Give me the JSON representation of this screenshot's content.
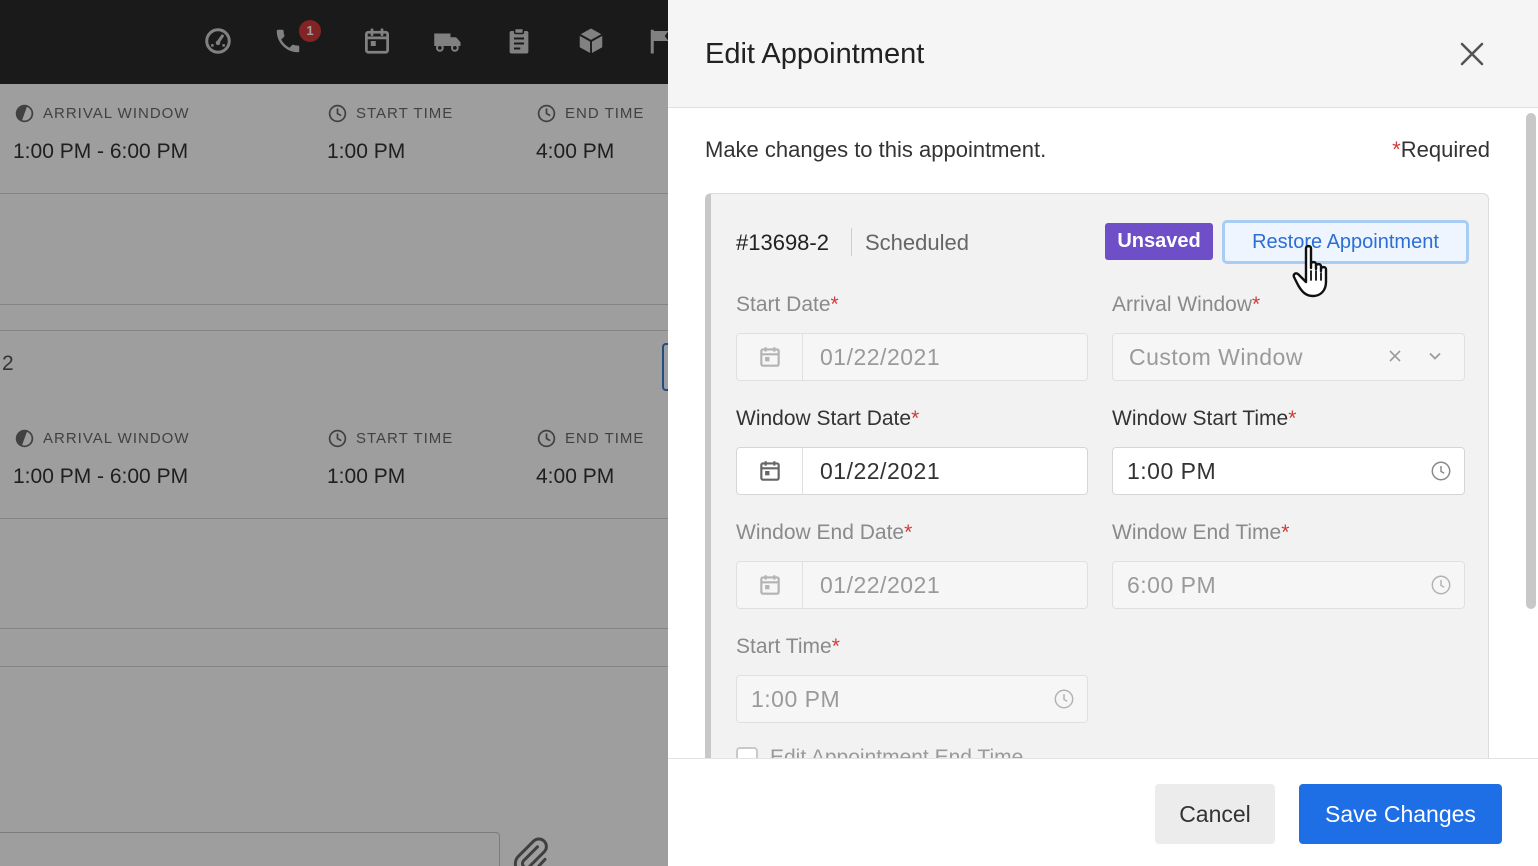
{
  "topbar": {
    "icons": [
      "dashboard-icon",
      "phone-icon",
      "calendar-icon",
      "truck-icon",
      "clipboard-icon",
      "box-icon",
      "flag-icon"
    ],
    "phone_badge": "1"
  },
  "background": {
    "rows": [
      {
        "arrival_window_label": "ARRIVAL WINDOW",
        "arrival_window_value": "1:00 PM - 6:00 PM",
        "start_time_label": "START TIME",
        "start_time_value": "1:00 PM",
        "end_time_label": "END TIME",
        "end_time_value": "4:00 PM"
      },
      {
        "arrival_window_label": "ARRIVAL WINDOW",
        "arrival_window_value": "1:00 PM - 6:00 PM",
        "start_time_label": "START TIME",
        "start_time_value": "1:00 PM",
        "end_time_label": "END TIME",
        "end_time_value": "4:00 PM"
      }
    ],
    "appointment_number_partial": "2"
  },
  "modal": {
    "title": "Edit Appointment",
    "intro": "Make changes to this appointment.",
    "required_star": "*",
    "required_label": "Required",
    "appointment": {
      "id": "#13698-2",
      "status": "Scheduled",
      "unsaved_badge": "Unsaved",
      "restore_label": "Restore Appointment"
    },
    "fields": {
      "start_date": {
        "label": "Start Date",
        "value": "01/22/2021"
      },
      "arrival_window": {
        "label": "Arrival Window",
        "value": "Custom Window"
      },
      "window_start_date": {
        "label": "Window Start Date",
        "value": "01/22/2021"
      },
      "window_start_time": {
        "label": "Window Start Time",
        "value": "1:00 PM"
      },
      "window_end_date": {
        "label": "Window End Date",
        "value": "01/22/2021"
      },
      "window_end_time": {
        "label": "Window End Time",
        "value": "6:00 PM"
      },
      "start_time": {
        "label": "Start Time",
        "value": "1:00 PM"
      },
      "edit_end_time": {
        "label": "Edit Appointment End Time"
      }
    },
    "footer": {
      "cancel_label": "Cancel",
      "save_label": "Save Changes"
    }
  },
  "colors": {
    "primary": "#1e6ee6",
    "unsaved": "#6f4fc8",
    "required": "#d23b3b",
    "topbar": "#2a2a2a"
  }
}
